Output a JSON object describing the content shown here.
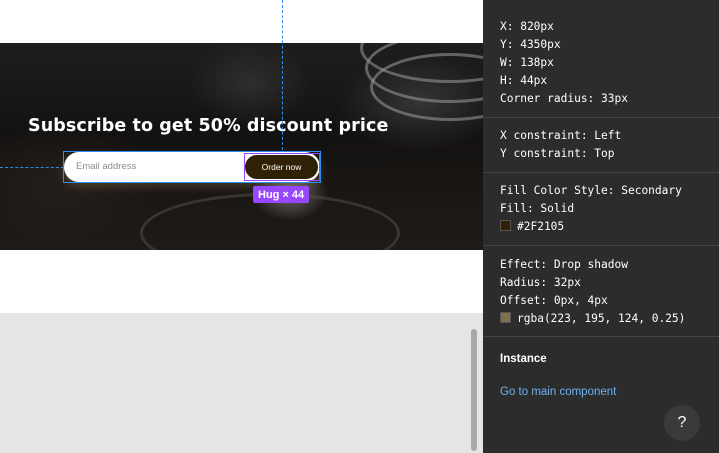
{
  "canvas": {
    "hero_title": "Subscribe to get 50% discount price",
    "email_placeholder": "Email address",
    "order_button_label": "Order now",
    "size_badge": "Hug × 44"
  },
  "inspector": {
    "position": {
      "x": "X: 820px",
      "y": "Y: 4350px",
      "w": "W: 138px",
      "h": "H: 44px",
      "corner_radius": "Corner radius: 33px"
    },
    "constraints": {
      "x": "X constraint: Left",
      "y": "Y constraint: Top"
    },
    "fill": {
      "style": "Fill Color Style: Secondary",
      "type": "Fill: Solid",
      "color_label": "#2F2105",
      "color": "#2F2105"
    },
    "effect": {
      "type": "Effect: Drop shadow",
      "radius": "Radius: 32px",
      "offset": "Offset: 0px, 4px",
      "color_label": "rgba(223, 195, 124, 0.25)",
      "color": "rgba(223, 195, 124, 0.25)"
    },
    "instance": {
      "title": "Instance",
      "link": "Go to main component"
    },
    "help_label": "?"
  },
  "colors": {
    "selection": "#2f8cf0",
    "component": "#9747ff",
    "panel_bg": "#2c2c2c",
    "link": "#6db3f2"
  }
}
